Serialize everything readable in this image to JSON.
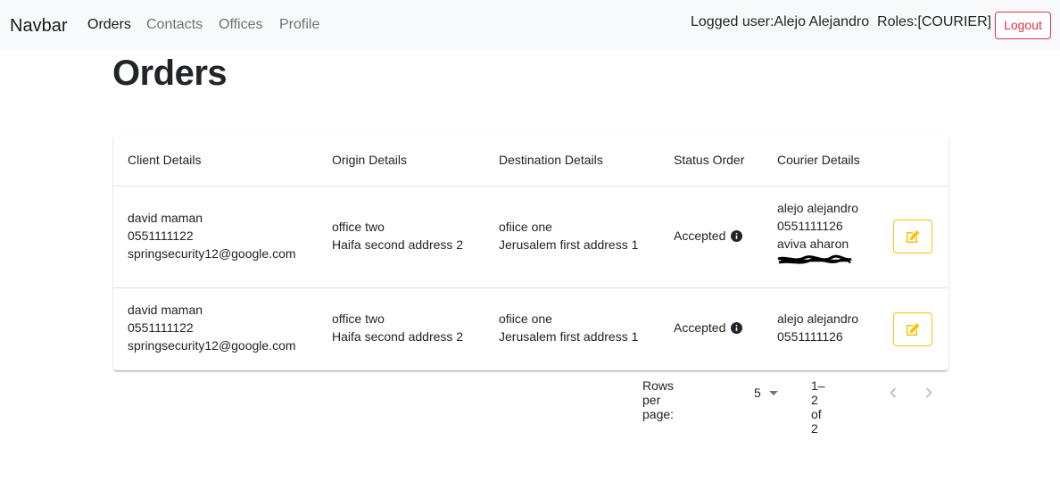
{
  "navbar": {
    "brand": "Navbar",
    "links": [
      "Orders",
      "Contacts",
      "Offices",
      "Profile"
    ],
    "user_info": "Logged user:Alejo Alejandro  Roles:[COURIER]",
    "logout_label": "Logout"
  },
  "page": {
    "title": "Orders"
  },
  "table": {
    "headers": [
      "Client Details",
      "Origin Details",
      "Destination Details",
      "Status Order",
      "Courier Details"
    ],
    "rows": [
      {
        "client": {
          "name": "david maman",
          "phone": "0551111122",
          "email": "springsecurity12@google.com"
        },
        "origin": {
          "name": "office two",
          "address": "Haifa second address 2"
        },
        "destination": {
          "name": "ofiice one",
          "address": "Jerusalem first address 1"
        },
        "status": "Accepted",
        "courier": {
          "name": "alejo alejandro",
          "phone": "0551111126",
          "name2": "aviva aharon"
        }
      },
      {
        "client": {
          "name": "david maman",
          "phone": "0551111122",
          "email": "springsecurity12@google.com"
        },
        "origin": {
          "name": "office two",
          "address": "Haifa second address 2"
        },
        "destination": {
          "name": "ofiice one",
          "address": "Jerusalem first address 1"
        },
        "status": "Accepted",
        "courier": {
          "name": "alejo alejandro",
          "phone": "0551111126"
        }
      }
    ]
  },
  "pagination": {
    "rows_per_page_label": "Rows per page:",
    "rows_per_page_value": "5",
    "range": "1–2 of 2"
  },
  "colors": {
    "navbar_bg": "#f8f9fa",
    "logout": "#dc3545",
    "edit_button": "#ffc107"
  },
  "icons": [
    "info-icon",
    "edit-icon",
    "chevron-left-icon",
    "chevron-right-icon",
    "dropdown-caret-icon"
  ]
}
